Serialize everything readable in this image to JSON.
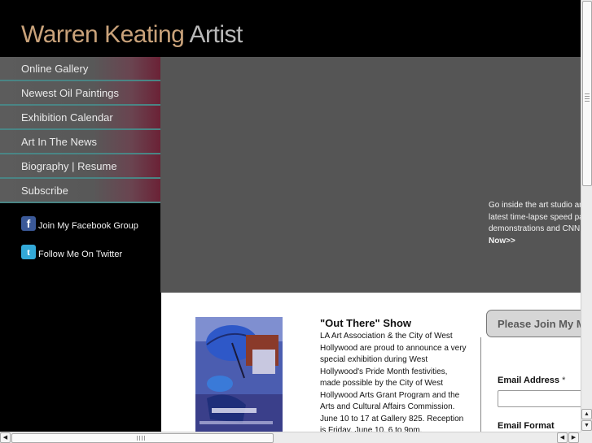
{
  "header": {
    "title_brand": "Warren Keating",
    "title_suffix": "Artist"
  },
  "nav": {
    "items": [
      {
        "label": "Online Gallery"
      },
      {
        "label": "Newest Oil Paintings"
      },
      {
        "label": "Exhibition Calendar"
      },
      {
        "label": "Art In The News"
      },
      {
        "label": "Biography | Resume"
      },
      {
        "label": "Subscribe"
      }
    ]
  },
  "social": {
    "facebook": {
      "label": "Join My Facebook Group",
      "icon": "facebook-icon"
    },
    "twitter": {
      "label": "Follow Me On Twitter",
      "icon": "twitter-icon"
    }
  },
  "banner": {
    "line1": "Go inside the art studio an",
    "line2": "latest time-lapse speed pa",
    "line3": "demonstrations and CNN",
    "now": "Now>>"
  },
  "news": {
    "title": "\"Out There\" Show",
    "body": "LA Art Association & the City of West Hollywood are proud to announce a very special exhibition during West Hollywood's Pride Month festivities, made possible by the City of West Hollywood Arts Grant Program and the Arts and Cultural Affairs Commission. June 10 to 17 at Gallery 825. Reception is Friday, June 10, 6 to 9pm."
  },
  "signup": {
    "title": "Please Join My M",
    "email_label": "Email Address",
    "required_mark": "*",
    "format_label": "Email Format"
  },
  "colors": {
    "title_brand": "#c9a27a",
    "title_suffix": "#b8b8b8",
    "nav_separator": "#4a8585",
    "banner_bg": "#555555"
  }
}
